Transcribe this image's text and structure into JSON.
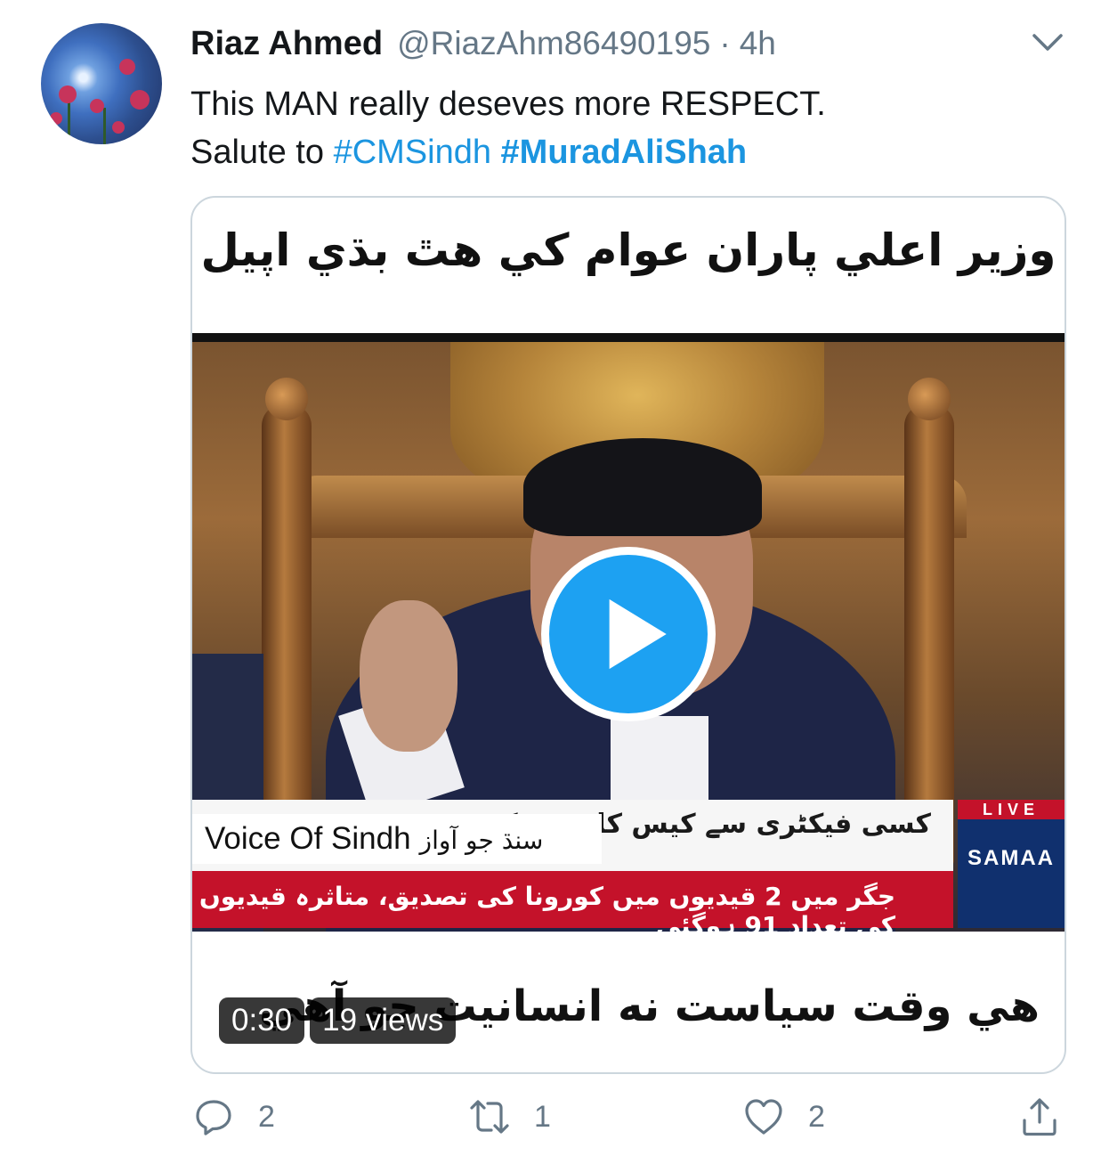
{
  "tweet": {
    "display_name": "Riaz Ahmed",
    "handle": "@RiazAhm86490195",
    "separator": "·",
    "time": "4h",
    "text_line1": "This MAN really deseves more RESPECT.",
    "text_line2_prefix": "Salute to ",
    "hashtag1": "#CMSindh",
    "hashtag2": "#MuradAliShah",
    "link_color": "#1b95e0"
  },
  "video": {
    "headline_top": "وزير اعلي پاران عوام کي هٿ بڌي اپيل",
    "headline_bottom": "هي وقت سياست نه انسانيت جو آهي",
    "ticker_line1": "کسی فیکٹری سے کیس کلاف فیکٹری",
    "ticker_line2": "جگر میں 2 قیدیوں میں کورونا کی تصدیق، متاثرہ قیدیوں کی تعداد 91 ہوگئی",
    "channel_live": "LIVE",
    "channel_name": "SAMAA",
    "watermark_en": "Voice Of Sindh",
    "watermark_sd": "سنڌ جو آواز",
    "duration": "0:30",
    "views": "19 views",
    "play_color": "#1da1f2"
  },
  "actions": {
    "reply_count": "2",
    "retweet_count": "1",
    "like_count": "2",
    "icons": [
      "reply-icon",
      "retweet-icon",
      "like-icon",
      "share-icon"
    ]
  }
}
